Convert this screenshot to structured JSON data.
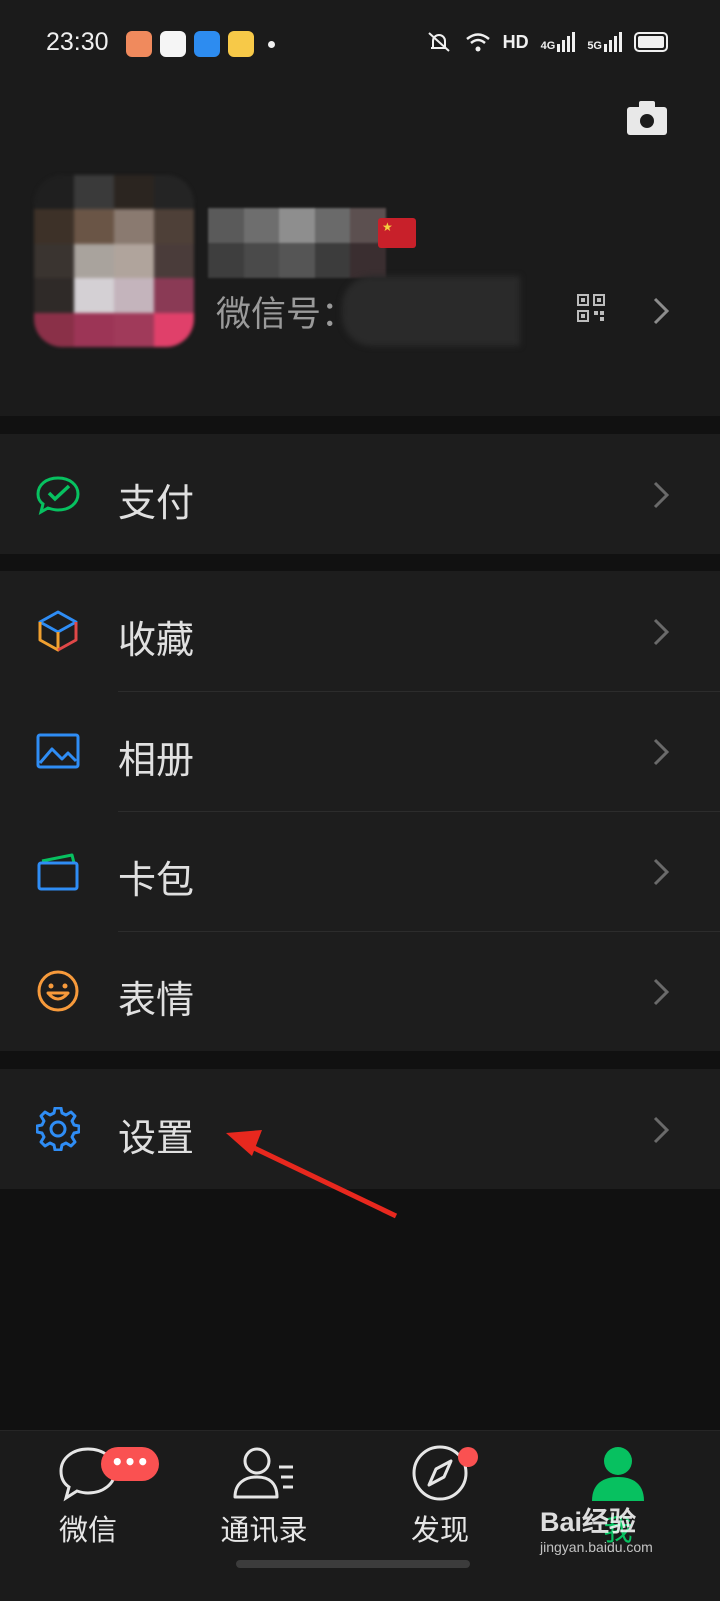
{
  "status_bar": {
    "time": "23:30",
    "notification_icons": [
      "payment-app-icon",
      "dog-app-icon",
      "blue-app-icon",
      "diamond-app-icon"
    ],
    "system_icons": [
      "mute-bell-icon",
      "wifi-icon",
      "hd-icon",
      "4g-signal-icon",
      "5g-signal-icon",
      "battery-icon"
    ],
    "hd_text": "HD",
    "net1_text": "4G",
    "net2_text": "5G"
  },
  "profile": {
    "wechat_id_label": "微信号："
  },
  "menu_groups": [
    [
      {
        "label": "支付",
        "icon": "pay-icon",
        "color": "#07c160"
      }
    ],
    [
      {
        "label": "收藏",
        "icon": "favorites-cube-icon",
        "color": "#f0a030"
      },
      {
        "label": "相册",
        "icon": "album-icon",
        "color": "#2f8df5"
      },
      {
        "label": "卡包",
        "icon": "card-wallet-icon",
        "color": "#2f8df5"
      },
      {
        "label": "表情",
        "icon": "emoji-icon",
        "color": "#f79a3b"
      }
    ],
    [
      {
        "label": "设置",
        "icon": "settings-gear-icon",
        "color": "#2f8df5"
      }
    ]
  ],
  "tabbar": {
    "tabs": [
      {
        "label": "微信",
        "icon": "chat-bubble-icon",
        "badge": "•••"
      },
      {
        "label": "通讯录",
        "icon": "contacts-icon"
      },
      {
        "label": "发现",
        "icon": "compass-icon"
      },
      {
        "label": "我",
        "icon": "me-person-icon",
        "active": true
      }
    ],
    "active_color": "#07c160"
  },
  "watermark": {
    "main": "Bai经验",
    "sub": "jingyan.baidu.com"
  }
}
